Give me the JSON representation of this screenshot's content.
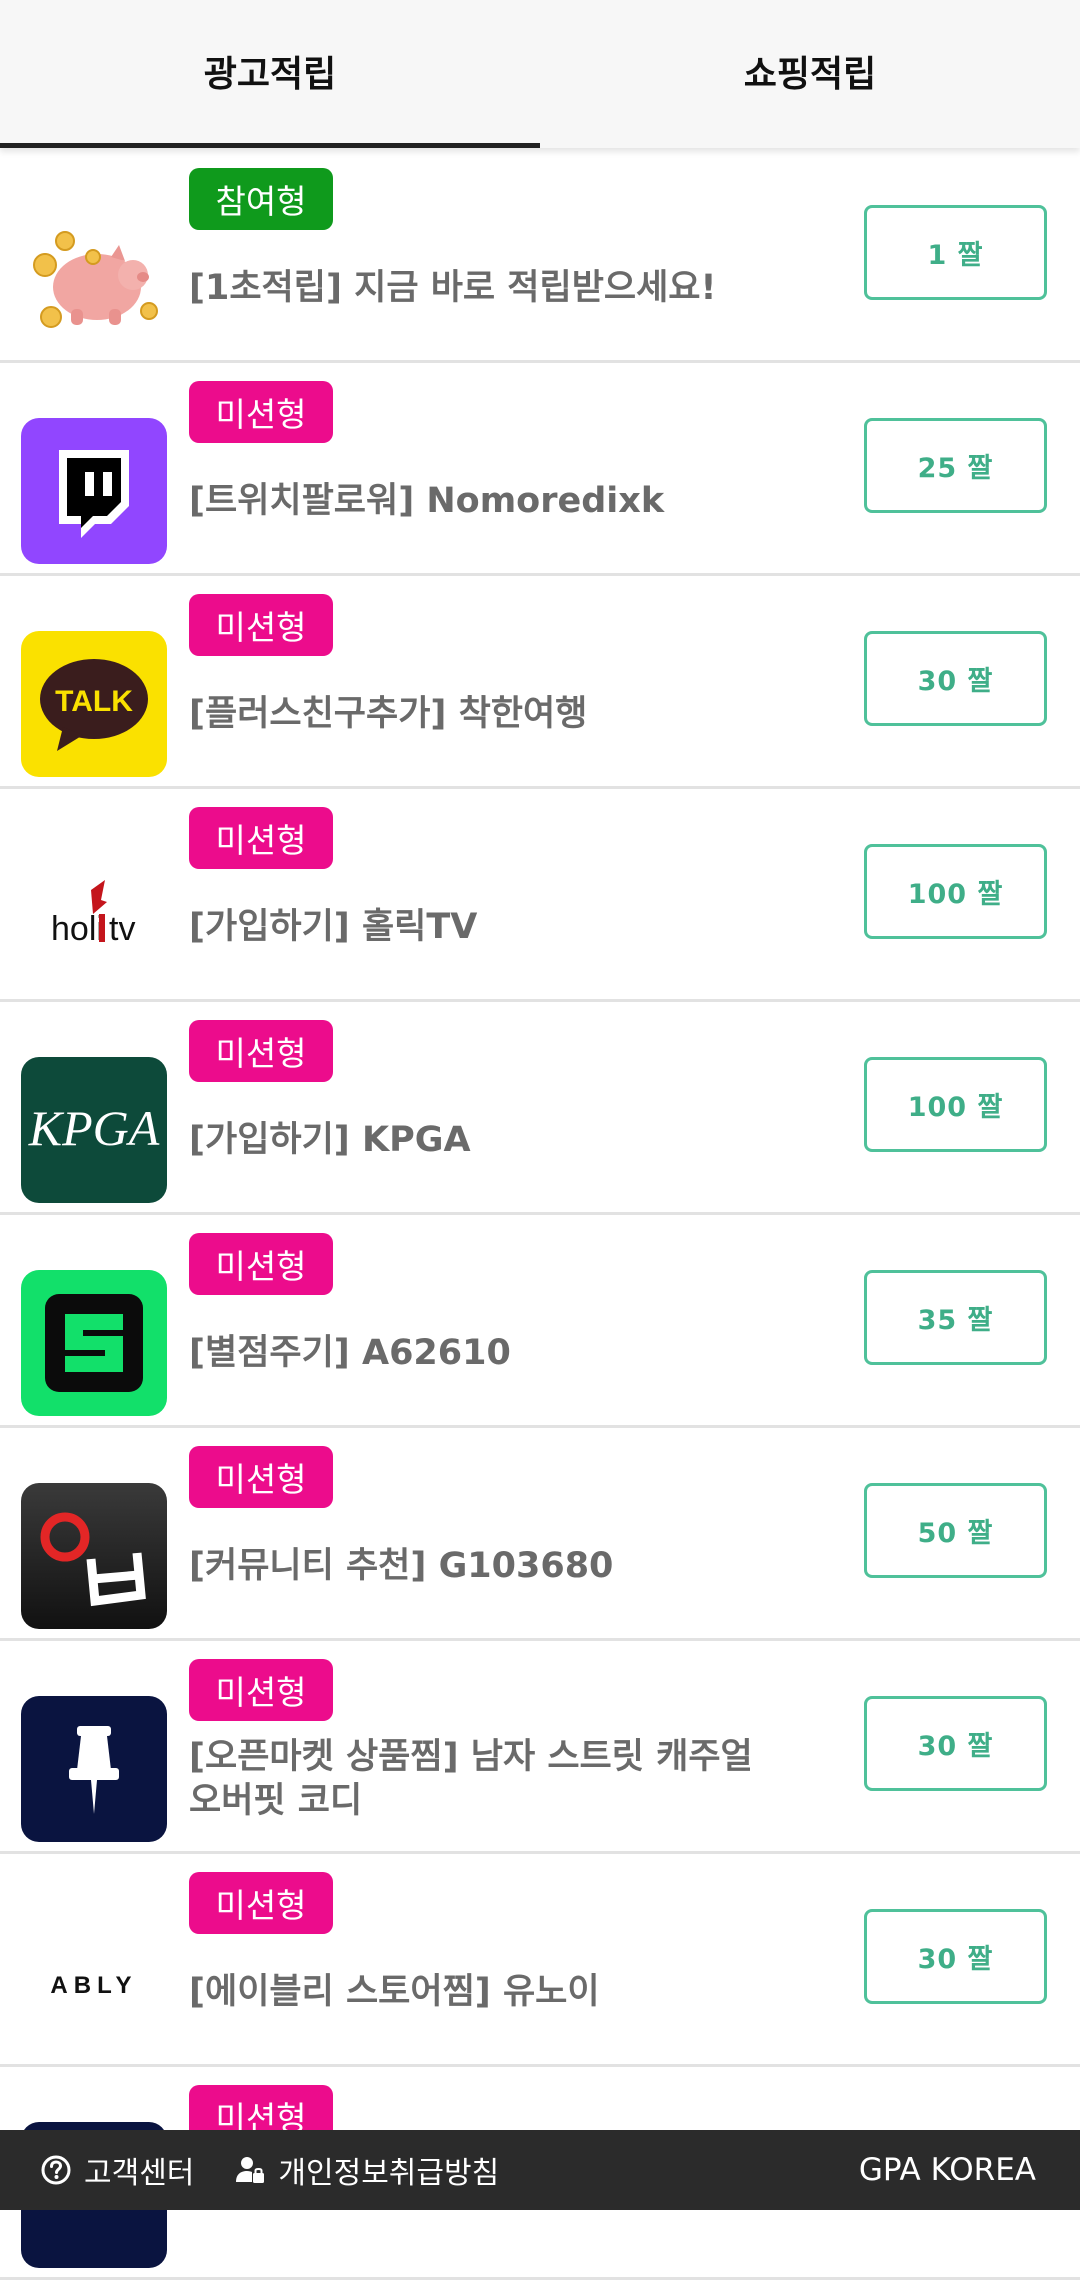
{
  "tabs": [
    {
      "label": "광고적립",
      "active": true
    },
    {
      "label": "쇼핑적립",
      "active": false
    }
  ],
  "items": [
    {
      "icon": "piggy-bank-icon",
      "badge": "참여형",
      "badge_color": "#0f9a1c",
      "title": "[1초적립] 지금 바로 적립받으세요!",
      "reward": "1 짤"
    },
    {
      "icon": "twitch-icon",
      "badge": "미션형",
      "badge_color": "#ec0c8c",
      "title": "[트위치팔로워] Nomoredixk",
      "reward": "25 짤"
    },
    {
      "icon": "kakaotalk-icon",
      "badge": "미션형",
      "badge_color": "#ec0c8c",
      "title": "[플러스친구추가] 착한여행",
      "reward": "30 짤"
    },
    {
      "icon": "holictv-logo",
      "badge": "미션형",
      "badge_color": "#ec0c8c",
      "title": "[가입하기] 홀릭TV",
      "reward": "100 짤"
    },
    {
      "icon": "kpga-logo",
      "badge": "미션형",
      "badge_color": "#ec0c8c",
      "title": "[가입하기] KPGA",
      "reward": "100 짤"
    },
    {
      "icon": "s-logo-icon",
      "badge": "미션형",
      "badge_color": "#ec0c8c",
      "title": "[별점주기] A62610",
      "reward": "35 짤"
    },
    {
      "icon": "community-logo",
      "badge": "미션형",
      "badge_color": "#ec0c8c",
      "title": "[커뮤니티 추천] G103680",
      "reward": "50 짤"
    },
    {
      "icon": "pin-icon",
      "badge": "미션형",
      "badge_color": "#ec0c8c",
      "title": "[오픈마켓 상품찜] 남자 스트릿 캐주얼 오버핏 코디",
      "reward": "30 짤"
    },
    {
      "icon": "ably-logo",
      "badge": "미션형",
      "badge_color": "#ec0c8c",
      "title": "[에이블리 스토어찜] 유노이",
      "reward": "30 짤"
    },
    {
      "icon": "partial-logo",
      "badge": "미션형",
      "badge_color": "#ec0c8c",
      "title": "",
      "reward": ""
    }
  ],
  "logo_text": {
    "talk": "TALK",
    "holic": "holi",
    "tv": "tv",
    "kpga": "KPGA",
    "ably": "ABLY"
  },
  "footer": {
    "help": "고객센터",
    "privacy": "개인정보취급방침",
    "brand": "GPA KOREA"
  }
}
